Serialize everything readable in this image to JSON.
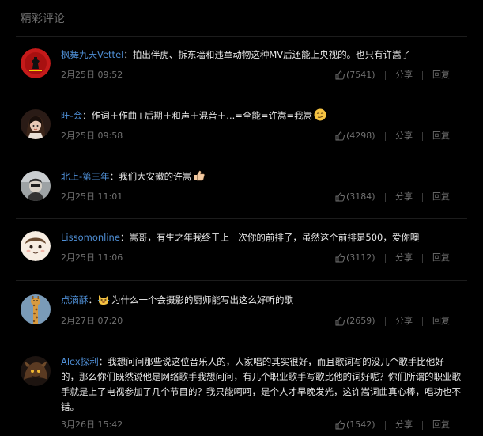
{
  "section_title": "精彩评论",
  "labels": {
    "share": "分享",
    "reply": "回复",
    "separator": "："
  },
  "comments": [
    {
      "username": "枫舞九天Vettel",
      "text": "拍出伴虎、拆东墙和违章动物这种MV后还能上央视的。也只有许嵩了",
      "timestamp": "2月25日 09:52",
      "likes": "(7541)",
      "avatar_icon": "ferrari-logo-avatar",
      "emoji": ""
    },
    {
      "username": "旺-会",
      "text": "作词＋作曲+后期＋和声＋混音＋...=全能=许嵩=我嵩",
      "timestamp": "2月25日 09:58",
      "likes": "(4298)",
      "avatar_icon": "anime-girl-avatar",
      "emoji": "smirk-emoji"
    },
    {
      "username": "北上-第三年",
      "text": "我们大安徽的许嵩",
      "timestamp": "2月25日 11:01",
      "likes": "(3184)",
      "avatar_icon": "portrait-avatar",
      "emoji": "thumbs-up-emoji"
    },
    {
      "username": "Lissomonline",
      "text": "嵩哥，有生之年我终于上一次你的前排了，虽然这个前排是500，爱你噢",
      "timestamp": "2月25日 11:06",
      "likes": "(3112)",
      "avatar_icon": "cartoon-face-avatar",
      "emoji": ""
    },
    {
      "username": "点滴酥",
      "text": "为什么一个会摄影的厨师能写出这么好听的歌",
      "timestamp": "2月27日 07:20",
      "likes": "(2659)",
      "avatar_icon": "giraffe-avatar",
      "emoji": "laughing-cat-emoji"
    },
    {
      "username": "Alex探利",
      "text": "我想问问那些说这位音乐人的，人家唱的其实很好，而且歌词写的没几个歌手比他好的，那么你们既然说他是网络歌手我想问问，有几个职业歌手写歌比他的词好呢？你们所谓的职业歌手就是上了电视参加了几个节目的？我只能呵呵，是个人才早晚发光，这许嵩词曲真心棒，唱功也不错。",
      "timestamp": "3月26日 15:42",
      "likes": "(1542)",
      "avatar_icon": "dark-creature-avatar",
      "emoji": ""
    }
  ],
  "colors": {
    "background": "#000000",
    "username": "#4f8fd6",
    "text": "#e8e8e8",
    "meta": "#717171",
    "title": "#6f6f6f"
  }
}
